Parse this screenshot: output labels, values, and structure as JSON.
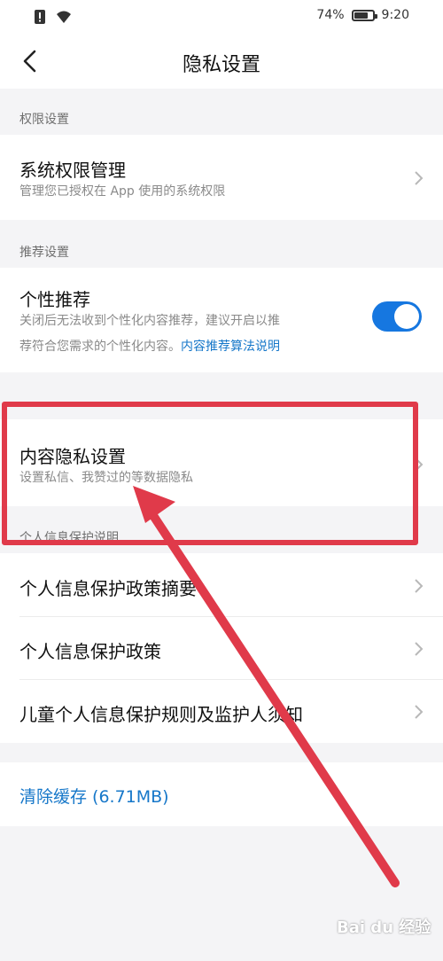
{
  "status_bar": {
    "battery_pct": "74%",
    "battery_level": 0.74,
    "time": "9:20"
  },
  "header": {
    "title": "隐私设置"
  },
  "sections": {
    "permissions": {
      "label": "权限设置",
      "item": {
        "title": "系统权限管理",
        "subtitle": "管理您已授权在 App 使用的系统权限"
      }
    },
    "recommend": {
      "label": "推荐设置",
      "item": {
        "title": "个性推荐",
        "subtitle_line1": "关闭后无法收到个性化内容推荐，建议开启以推",
        "subtitle_line2": "荐符合您需求的个性化内容。",
        "link": "内容推荐算法说明",
        "toggle_on": true
      }
    },
    "content_privacy": {
      "item": {
        "title": "内容隐私设置",
        "subtitle": "设置私信、我赞过的等数据隐私"
      }
    },
    "info_protection": {
      "label": "个人信息保护说明",
      "items": [
        "个人信息保护政策摘要",
        "个人信息保护政策",
        "儿童个人信息保护规则及监护人须知"
      ]
    }
  },
  "cache": {
    "label": "清除缓存 (6.71MB)"
  },
  "watermark": "Bai du 经验",
  "colors": {
    "accent": "#1677c9",
    "toggle": "#1677e0",
    "highlight": "#e03a4a"
  }
}
